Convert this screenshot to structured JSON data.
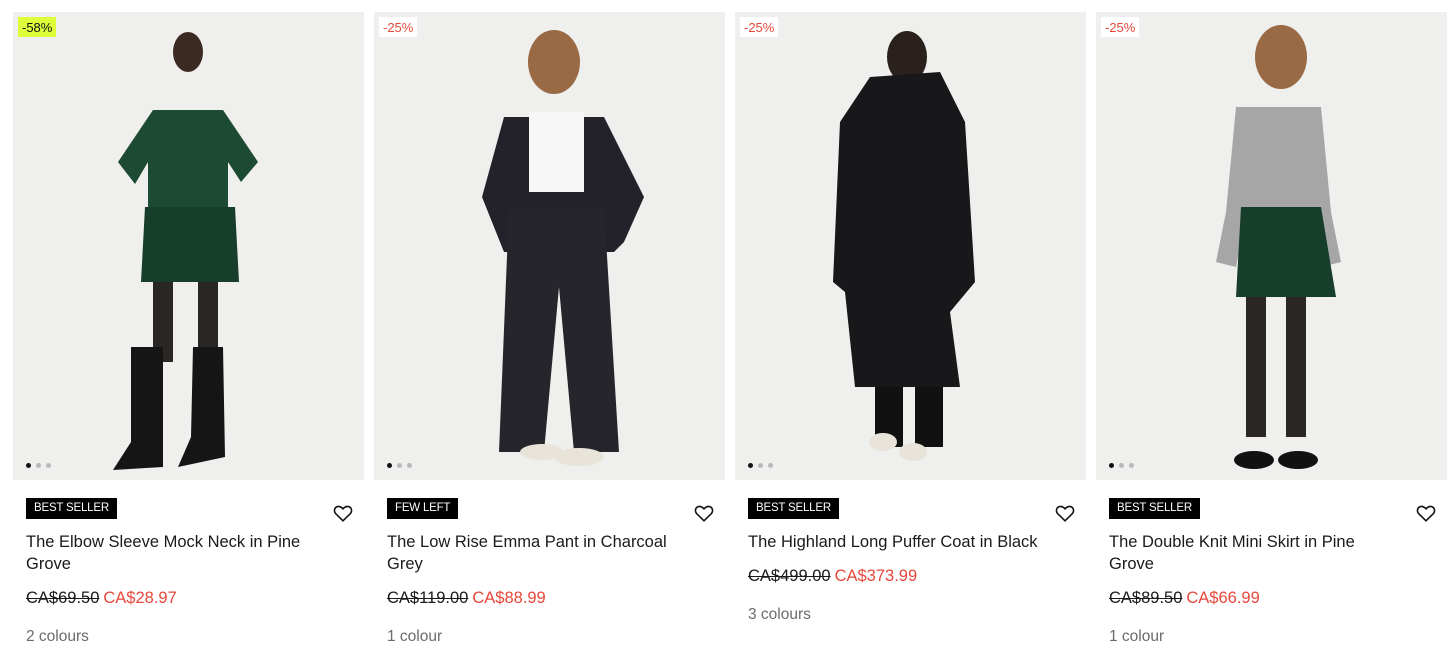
{
  "products": [
    {
      "discount": "-58%",
      "badge": "BEST SELLER",
      "title": "The Elbow Sleeve Mock Neck in Pine Grove",
      "old_price": "CA$69.50",
      "new_price": "CA$28.97",
      "colours": "2 colours"
    },
    {
      "discount": "-25%",
      "badge": "FEW LEFT",
      "title": "The Low Rise Emma Pant in Charcoal Grey",
      "old_price": "CA$119.00",
      "new_price": "CA$88.99",
      "colours": "1 colour"
    },
    {
      "discount": "-25%",
      "badge": "BEST SELLER",
      "title": "The Highland Long Puffer Coat in Black",
      "old_price": "CA$499.00",
      "new_price": "CA$373.99",
      "colours": "3 colours"
    },
    {
      "discount": "-25%",
      "badge": "BEST SELLER",
      "title": "The Double Knit Mini Skirt in Pine Grove",
      "old_price": "CA$89.50",
      "new_price": "CA$66.99",
      "colours": "1 colour"
    }
  ],
  "colors": {
    "sale_red": "#e5483a",
    "highlight_badge": "#dcff3a",
    "image_bg": "#efefee"
  },
  "icons": {
    "wishlist": "heart-outline-icon"
  }
}
